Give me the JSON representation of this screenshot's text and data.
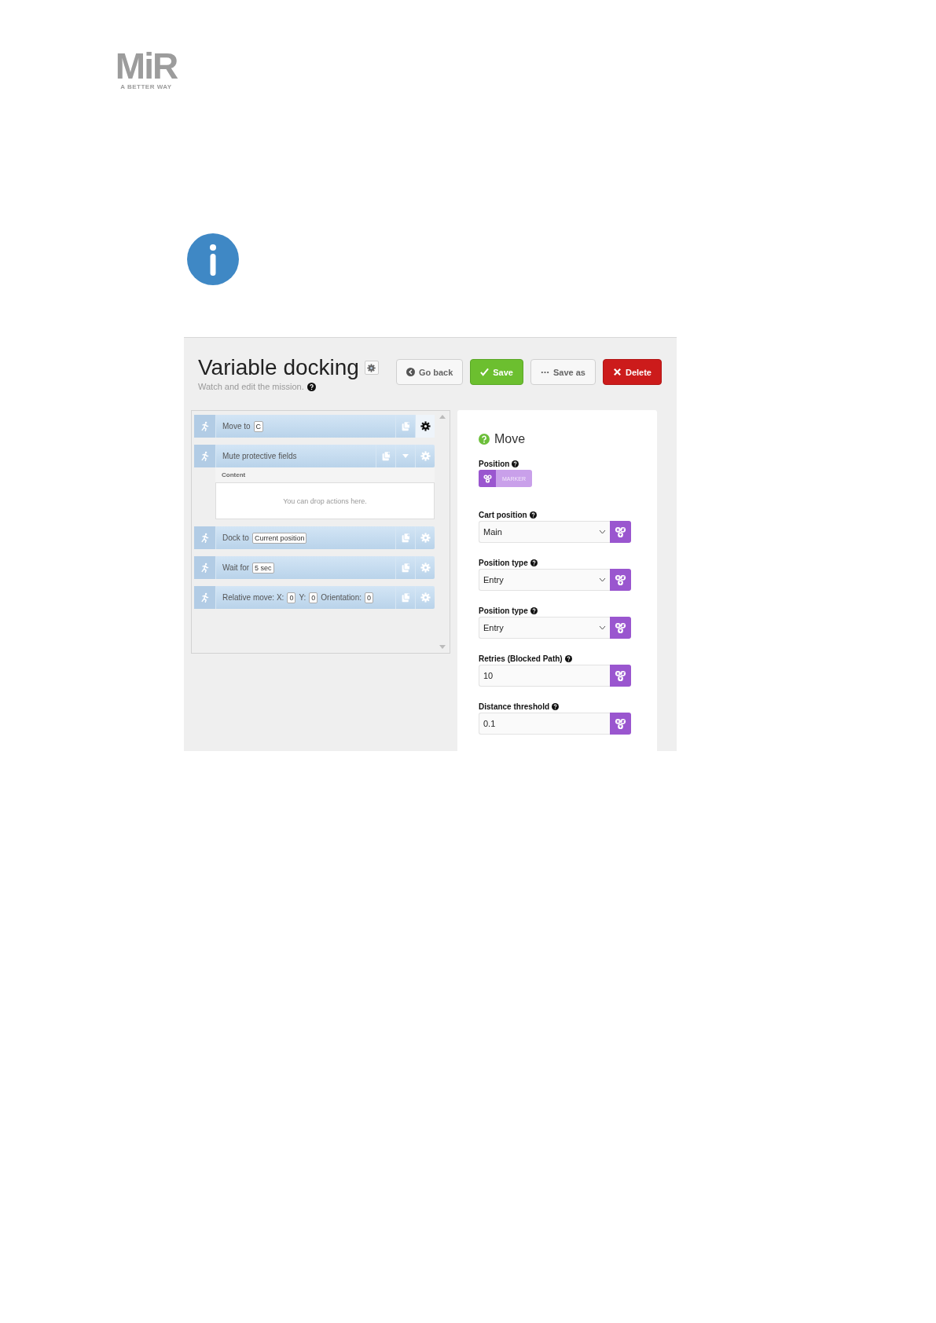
{
  "logo": {
    "mark": "MiR",
    "tagline": "A BETTER WAY"
  },
  "mission": {
    "title": "Variable docking",
    "subtitle": "Watch and edit the mission.",
    "buttons": [
      {
        "label": "Go back",
        "kind": "back"
      },
      {
        "label": "Save",
        "kind": "save"
      },
      {
        "label": "Save as",
        "kind": "saveas"
      },
      {
        "label": "Delete",
        "kind": "delete"
      }
    ],
    "actions": [
      {
        "parts": [
          {
            "text": "Move to"
          },
          {
            "chip": "C"
          }
        ],
        "selected": true,
        "expanded": false
      },
      {
        "parts": [
          {
            "text": "Mute protective fields"
          }
        ],
        "selected": false,
        "expanded": true,
        "content_label": "Content",
        "drop_hint": "You can drop actions here."
      },
      {
        "parts": [
          {
            "text": "Dock to"
          },
          {
            "chip": "Current position"
          }
        ],
        "selected": false,
        "expanded": false
      },
      {
        "parts": [
          {
            "text": "Wait for"
          },
          {
            "chip": "5 sec"
          }
        ],
        "selected": false,
        "expanded": false
      },
      {
        "parts": [
          {
            "text": "Relative move: X:"
          },
          {
            "chip": "0"
          },
          {
            "text": "Y:"
          },
          {
            "chip": "0"
          },
          {
            "text": "Orientation:"
          },
          {
            "chip": "0"
          }
        ],
        "selected": false,
        "expanded": false
      }
    ],
    "editor": {
      "heading": "Move",
      "fields": [
        {
          "label": "Position",
          "kind": "marker",
          "value": "MARKER"
        },
        {
          "label": "Cart position",
          "kind": "select",
          "value": "Main"
        },
        {
          "label": "Position type",
          "kind": "select",
          "value": "Entry"
        },
        {
          "label": "Position type",
          "kind": "select",
          "value": "Entry"
        },
        {
          "label": "Retries (Blocked Path)",
          "kind": "input",
          "value": "10"
        },
        {
          "label": "Distance threshold",
          "kind": "input",
          "value": "0.1"
        }
      ]
    }
  }
}
